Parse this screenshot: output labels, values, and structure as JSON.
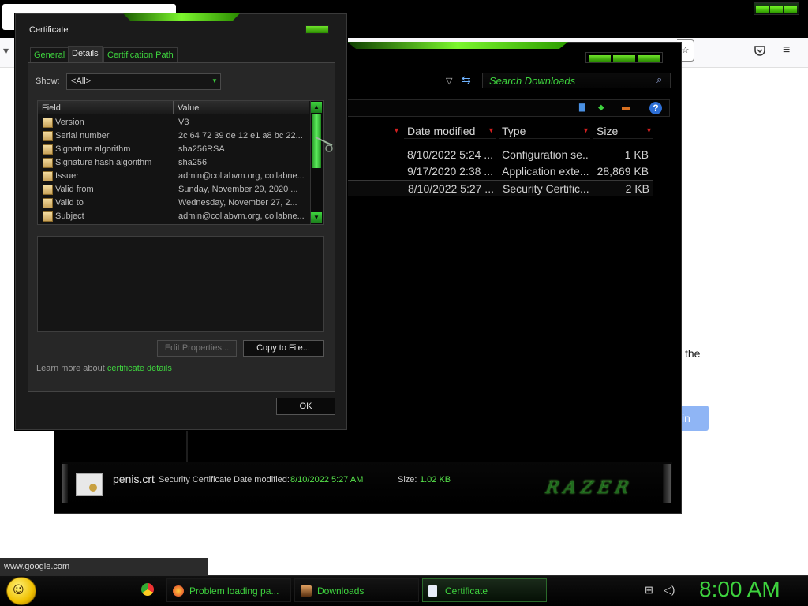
{
  "browser": {
    "status_url": "www.google.com",
    "page_text_fragment": "the",
    "page_button_fragment": "in"
  },
  "explorer": {
    "search_placeholder": "Search Downloads",
    "columns": [
      "Date modified",
      "Type",
      "Size"
    ],
    "files": [
      {
        "date": "8/10/2022 5:24 ...",
        "type": "Configuration se...",
        "size": "1 KB"
      },
      {
        "date": "9/17/2020 2:38 ...",
        "type": "Application exte...",
        "size": "28,869 KB"
      },
      {
        "date": "8/10/2022 5:27 ...",
        "type": "Security Certific...",
        "size": "2 KB"
      }
    ],
    "details_pane": {
      "file_name": "penis.crt",
      "file_type": "Security Certificate",
      "date_modified_label": "Date modified:",
      "date_modified_value": "8/10/2022 5:27 AM",
      "size_label": "Size:",
      "size_value": "1.02 KB",
      "logo_text": "RAZER"
    }
  },
  "cert_dialog": {
    "title": "Certificate",
    "tabs": [
      "General",
      "Details",
      "Certification Path"
    ],
    "show_label": "Show:",
    "show_value": "<All>",
    "list_header": {
      "field": "Field",
      "value": "Value"
    },
    "rows": [
      {
        "field": "Version",
        "value": "V3"
      },
      {
        "field": "Serial number",
        "value": "2c 64 72 39 de 12 e1 a8 bc 22..."
      },
      {
        "field": "Signature algorithm",
        "value": "sha256RSA"
      },
      {
        "field": "Signature hash algorithm",
        "value": "sha256"
      },
      {
        "field": "Issuer",
        "value": "admin@collabvm.org, collabne..."
      },
      {
        "field": "Valid from",
        "value": "Sunday, November 29, 2020 ..."
      },
      {
        "field": "Valid to",
        "value": "Wednesday, November 27, 2..."
      },
      {
        "field": "Subject",
        "value": "admin@collabvm.org, collabne..."
      }
    ],
    "edit_button": "Edit Properties...",
    "copy_button": "Copy to File...",
    "learn_more_text": "Learn more about",
    "learn_more_link": "certificate details",
    "ok_button": "OK"
  },
  "taskbar": {
    "items": [
      {
        "label": "Problem loading pa...",
        "icon": "firefox-icon"
      },
      {
        "label": "Downloads",
        "icon": "folder-icon"
      },
      {
        "label": "Certificate",
        "icon": "certificate-icon"
      }
    ],
    "clock": "8:00 AM"
  },
  "colors": {
    "accent_green": "#3ed33e",
    "background": "#000000"
  }
}
